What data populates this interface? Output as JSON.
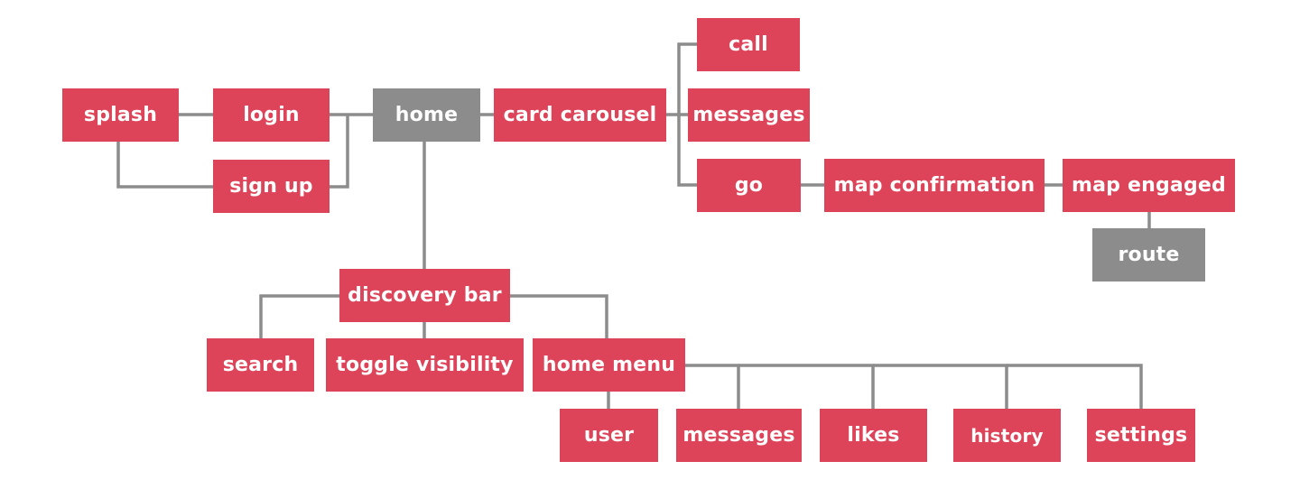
{
  "colors": {
    "primary": "#DE4459",
    "secondary": "#8C8C8C",
    "connector": "#8C8C8C"
  },
  "nodes": [
    {
      "id": "splash",
      "label": "splash",
      "kind": "primary"
    },
    {
      "id": "login",
      "label": "login",
      "kind": "primary"
    },
    {
      "id": "sign-up",
      "label": "sign up",
      "kind": "primary"
    },
    {
      "id": "home",
      "label": "home",
      "kind": "secondary"
    },
    {
      "id": "card-carousel",
      "label": "card carousel",
      "kind": "primary"
    },
    {
      "id": "call",
      "label": "call",
      "kind": "primary"
    },
    {
      "id": "messages-card",
      "label": "messages",
      "kind": "primary"
    },
    {
      "id": "go",
      "label": "go",
      "kind": "primary"
    },
    {
      "id": "map-confirmation",
      "label": "map confirmation",
      "kind": "primary"
    },
    {
      "id": "map-engaged",
      "label": "map engaged",
      "kind": "primary"
    },
    {
      "id": "route",
      "label": "route",
      "kind": "secondary"
    },
    {
      "id": "discovery-bar",
      "label": "discovery bar",
      "kind": "primary"
    },
    {
      "id": "search",
      "label": "search",
      "kind": "primary"
    },
    {
      "id": "toggle-visibility",
      "label": "toggle visibility",
      "kind": "primary"
    },
    {
      "id": "home-menu",
      "label": "home menu",
      "kind": "primary"
    },
    {
      "id": "user",
      "label": "user",
      "kind": "primary"
    },
    {
      "id": "messages-menu",
      "label": "messages",
      "kind": "primary"
    },
    {
      "id": "likes",
      "label": "likes",
      "kind": "primary"
    },
    {
      "id": "history",
      "label": "history",
      "kind": "primary"
    },
    {
      "id": "settings",
      "label": "settings",
      "kind": "primary"
    }
  ],
  "edges": [
    [
      "splash",
      "login"
    ],
    [
      "splash",
      "sign-up"
    ],
    [
      "login",
      "home"
    ],
    [
      "sign-up",
      "home"
    ],
    [
      "home",
      "card-carousel"
    ],
    [
      "card-carousel",
      "call"
    ],
    [
      "card-carousel",
      "messages-card"
    ],
    [
      "card-carousel",
      "go"
    ],
    [
      "go",
      "map-confirmation"
    ],
    [
      "map-confirmation",
      "map-engaged"
    ],
    [
      "map-engaged",
      "route"
    ],
    [
      "home",
      "discovery-bar"
    ],
    [
      "discovery-bar",
      "search"
    ],
    [
      "discovery-bar",
      "toggle-visibility"
    ],
    [
      "discovery-bar",
      "home-menu"
    ],
    [
      "home-menu",
      "user"
    ],
    [
      "home-menu",
      "messages-menu"
    ],
    [
      "home-menu",
      "likes"
    ],
    [
      "home-menu",
      "history"
    ],
    [
      "home-menu",
      "settings"
    ]
  ]
}
